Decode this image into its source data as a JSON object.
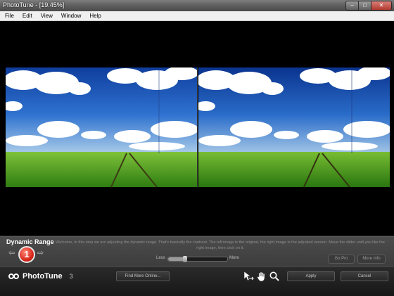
{
  "window": {
    "title": "PhotoTune - [19.45%]",
    "controls": [
      "minimize-icon",
      "maximize-icon",
      "close-icon"
    ]
  },
  "menu": {
    "items": [
      "File",
      "Edit",
      "View",
      "Window",
      "Help"
    ]
  },
  "step": {
    "title": "Dynamic Range",
    "number": "1",
    "description": "Welcome, in this step we are adjusting the dynamic range. That's basically the contrast. The left image is the original, the right image is the adjusted version. Move the slider until you like the right image, then click on it.",
    "slider": {
      "less_label": "Less",
      "more_label": "More",
      "value": 0.28
    },
    "go_pro_label": "Go Pro",
    "more_info_label": "More Info"
  },
  "bottom": {
    "brand_name": "PhotoTune",
    "version": "3",
    "find_more_label": "Find More Online...",
    "apply_label": "Apply",
    "cancel_label": "Cancel",
    "tools": [
      "compare-cursor-icon",
      "hand-icon",
      "zoom-icon"
    ]
  },
  "colors": {
    "sky_top": "#1a4fb8",
    "grass": "#4aa81e",
    "step_badge": "#d9281b"
  }
}
